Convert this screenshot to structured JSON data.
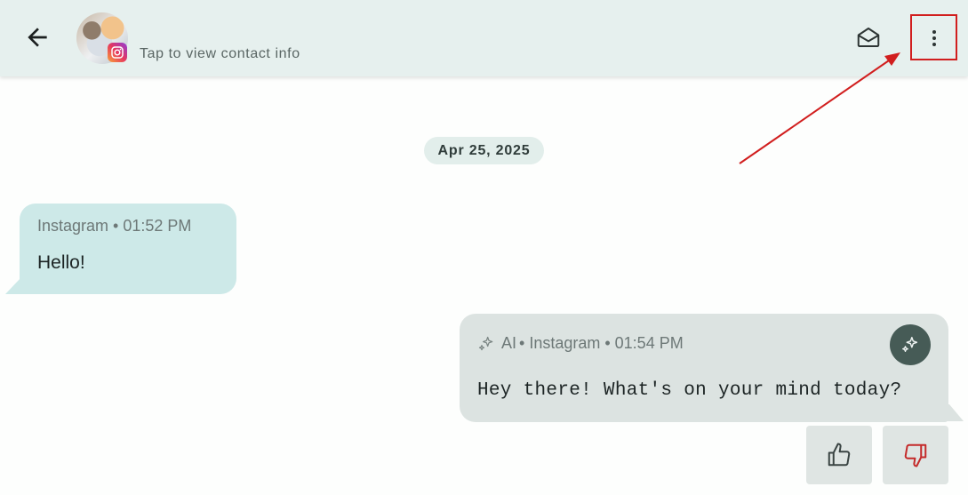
{
  "header": {
    "contact_info_label": "Tap to view contact info",
    "icons": {
      "back": "arrow-left-icon",
      "avatar": "avatar",
      "platform": "instagram-icon",
      "mail": "envelope-open-icon",
      "more": "more-vertical-icon"
    }
  },
  "date_divider": "Apr 25, 2025",
  "messages": [
    {
      "direction": "incoming",
      "meta": "Instagram • 01:52 PM",
      "text": "Hello!"
    },
    {
      "direction": "outgoing",
      "ai_label": "AI",
      "meta": "• Instagram • 01:54 PM",
      "text": "Hey there! What's on your mind today?"
    }
  ],
  "feedback": {
    "like_icon": "thumbs-up-icon",
    "dislike_icon": "thumbs-down-icon"
  },
  "colors": {
    "header_bg": "#e6f0ee",
    "incoming_bubble": "#cde9e8",
    "outgoing_bubble": "#dce3e1",
    "ai_button": "#465b56",
    "highlight_red": "#d11e1e"
  }
}
